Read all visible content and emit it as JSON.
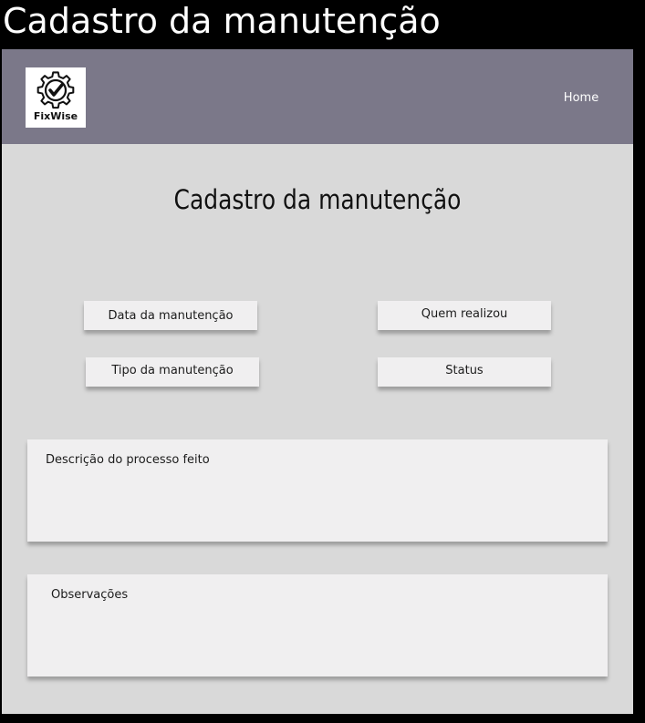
{
  "window": {
    "title": "Cadastro da manutenção"
  },
  "navbar": {
    "logo_text": "FixWise",
    "logo_icon": "gear-check-icon",
    "home_label": "Home",
    "background_color": "#7b7889"
  },
  "main": {
    "title": "Cadastro da manutenção",
    "fields": {
      "data_placeholder": "Data da manutenção",
      "quem_placeholder": "Quem realizou",
      "tipo_placeholder": "Tipo da manutenção",
      "status_placeholder": "Status"
    },
    "textareas": {
      "descricao_placeholder": "Descrição do processo feito",
      "observacoes_placeholder": "Observações"
    },
    "background_color": "#d9d9d9",
    "field_color": "#f0eff0"
  }
}
